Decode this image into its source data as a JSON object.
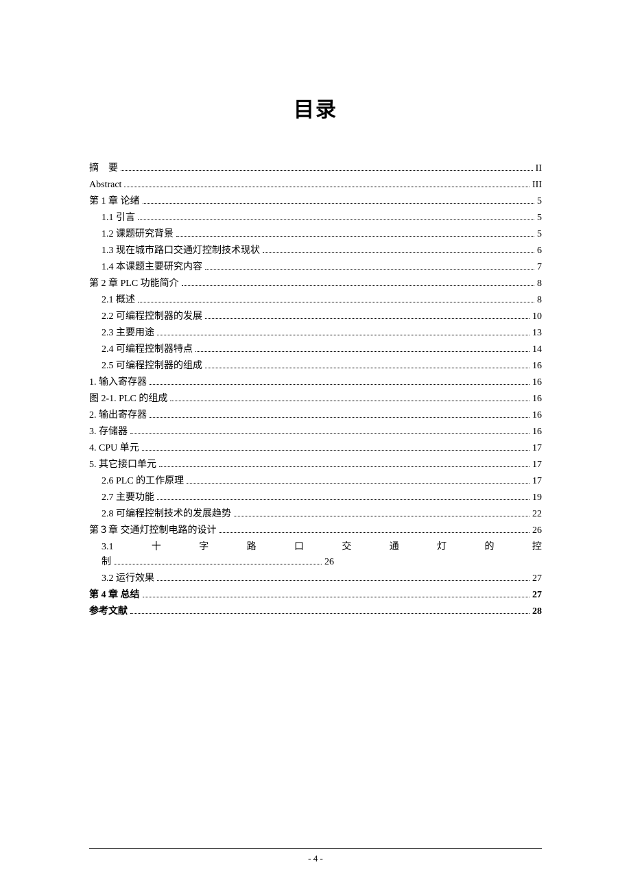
{
  "title": "目录",
  "toc": [
    {
      "label": "摘 要",
      "page": "II",
      "indent": 0
    },
    {
      "label": "Abstract",
      "page": "III",
      "indent": 0
    },
    {
      "label": "第 1 章 论绪",
      "page": "5",
      "indent": 0
    },
    {
      "label": "1.1 引言",
      "page": "5",
      "indent": 1
    },
    {
      "label": "1.2 课题研究背景",
      "page": "5",
      "indent": 1
    },
    {
      "label": "1.3 现在城市路口交通灯控制技术现状",
      "page": "6",
      "indent": 1
    },
    {
      "label": "1.4 本课题主要研究内容",
      "page": "7",
      "indent": 1
    },
    {
      "label": "第 2 章 PLC 功能简介",
      "page": "8",
      "indent": 0
    },
    {
      "label": "2.1 概述",
      "page": "8",
      "indent": 1
    },
    {
      "label": "2.2 可编程控制器的发展",
      "page": "10",
      "indent": 1
    },
    {
      "label": "2.3 主要用途",
      "page": "13",
      "indent": 1
    },
    {
      "label": "2.4 可编程控制器特点",
      "page": "14",
      "indent": 1
    },
    {
      "label": "2.5 可编程控制器的组成",
      "page": "16",
      "indent": 1
    },
    {
      "label": "1. 输入寄存器",
      "page": "16",
      "indent": 0
    },
    {
      "label": "图 2-1. PLC 的组成",
      "page": "16",
      "indent": 0
    },
    {
      "label": "2. 输出寄存器",
      "page": "16",
      "indent": 0
    },
    {
      "label": "3. 存储器",
      "page": "16",
      "indent": 0
    },
    {
      "label": "4. CPU 单元",
      "page": "17",
      "indent": 0
    },
    {
      "label": "5. 其它接口单元",
      "page": "17",
      "indent": 0
    },
    {
      "label": "2.6 PLC 的工作原理",
      "page": "17",
      "indent": 1
    },
    {
      "label": "2.7 主要功能",
      "page": "19",
      "indent": 1
    },
    {
      "label": "2.8 可编程控制技术的发展趋势",
      "page": "22",
      "indent": 1
    },
    {
      "label": "第３章 交通灯控制电路的设计",
      "page": "26",
      "indent": 0
    }
  ],
  "distributedRow": {
    "number": "3.1",
    "chars": [
      "十",
      "字",
      "路",
      "口",
      "交",
      "通",
      "灯",
      "的",
      "控"
    ],
    "line2_label": "制",
    "line2_page": "26"
  },
  "tail": [
    {
      "label": "3.2 运行效果",
      "page": "27",
      "indent": 1
    },
    {
      "label": "第 4 章 总结",
      "page": "27",
      "indent": 0,
      "bold": true
    },
    {
      "label": "参考文献",
      "page": "28",
      "indent": 0,
      "bold": true
    }
  ],
  "footer": "- 4 -"
}
